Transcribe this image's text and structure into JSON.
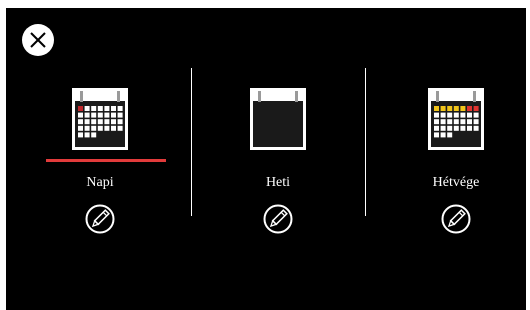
{
  "dialog": {
    "close_icon": "close-x-circle-icon",
    "options": [
      {
        "label": "Napi",
        "selected": true,
        "icon": "calendar-daily-icon",
        "edit_icon": "pencil-edit-icon"
      },
      {
        "label": "Heti",
        "selected": false,
        "icon": "calendar-weekly-icon",
        "edit_icon": "pencil-edit-icon"
      },
      {
        "label": "Hétvége",
        "selected": false,
        "icon": "calendar-weekend-icon",
        "edit_icon": "pencil-edit-icon"
      }
    ]
  },
  "colors": {
    "background": "#000000",
    "text": "#ffffff",
    "selection_underline": "#e23b3b",
    "day_highlight": "#c0262b",
    "weekend_yellow": "#f2c51a",
    "weekend_red": "#e0332f"
  }
}
